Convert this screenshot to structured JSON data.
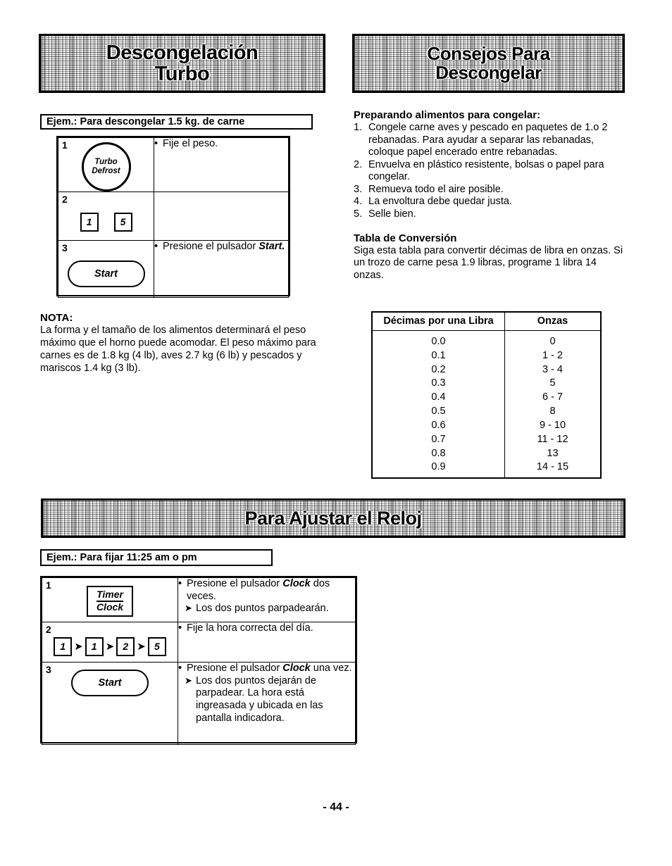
{
  "page": {
    "number_label": "- 44 -"
  },
  "sections": {
    "defrost": {
      "banner_line1": "Descongelación",
      "banner_line2": "Turbo",
      "example_label": "Ejem.: Para descongelar 1.5 kg. de carne",
      "steps": [
        {
          "num": "1",
          "key_type": "circle",
          "key_line1": "Turbo",
          "key_line2": "Defrost",
          "desc_bullet": "Fije el peso."
        },
        {
          "num": "2",
          "key_type": "squares",
          "keys": [
            "1",
            "5"
          ],
          "desc_bullet": ""
        },
        {
          "num": "3",
          "key_type": "start",
          "key_label": "Start",
          "desc_bullet": "Presione el pulsador",
          "desc_bold": "Start."
        }
      ],
      "note_heading": "NOTA:",
      "note_text": "La forma y el tamaño de los alimentos determinará el peso máximo que el horno puede acomodar. El peso máximo para carnes es de 1.8 kg (4 lb), aves 2.7 kg (6 lb) y pescados y mariscos 1.4 kg (3 lb)."
    },
    "tips": {
      "banner_line1": "Consejos Para",
      "banner_line2": "Descongelar",
      "prep_heading": "Preparando alimentos para congelar:",
      "prep_items": [
        {
          "n": "1.",
          "text": "Congele carne aves y pescado en paquetes de 1.o 2 rebanadas. Para ayudar a separar las rebanadas, coloque papel encerado entre rebanadas."
        },
        {
          "n": "2.",
          "text": "Envuelva en plástico resistente, bolsas o papel para congelar."
        },
        {
          "n": "3.",
          "text": "Remueva todo el aire posible."
        },
        {
          "n": "4.",
          "text": "La envoltura debe quedar justa."
        },
        {
          "n": "5.",
          "text": "Selle bien."
        }
      ],
      "conv_heading": "Tabla de Conversión",
      "conv_intro": "Siga esta tabla para convertir décimas de libra en onzas. Si un trozo de carne pesa 1.9 libras, programe 1 libra 14 onzas.",
      "conv_table": {
        "headers": [
          "Décimas por una Libra",
          "Onzas"
        ],
        "rows": [
          [
            "0.0",
            "0"
          ],
          [
            "0.1",
            "1 - 2"
          ],
          [
            "0.2",
            "3 - 4"
          ],
          [
            "0.3",
            "5"
          ],
          [
            "0.4",
            "6 - 7"
          ],
          [
            "0.5",
            "8"
          ],
          [
            "0.6",
            "9 - 10"
          ],
          [
            "0.7",
            "11 - 12"
          ],
          [
            "0.8",
            "13"
          ],
          [
            "0.9",
            "14 - 15"
          ]
        ]
      }
    },
    "clock": {
      "banner_title": "Para Ajustar el Reloj",
      "example_label": "Ejem.: Para fijar 11:25 am o pm",
      "steps": [
        {
          "num": "1",
          "key_type": "rect",
          "key_line1": "Timer",
          "key_line2": "Clock",
          "desc_pre": "Presione el pulsador",
          "desc_bold": "Clock",
          "desc_post": "dos veces.",
          "desc_arrow": "Los dos puntos parpadearán."
        },
        {
          "num": "2",
          "key_type": "sequence",
          "keys": [
            "1",
            "1",
            "2",
            "5"
          ],
          "desc_pre": "Fije la hora correcta del día.",
          "desc_bold": "",
          "desc_post": "",
          "desc_arrow": ""
        },
        {
          "num": "3",
          "key_type": "start",
          "key_label": "Start",
          "desc_pre": "Presione el pulsador",
          "desc_bold": "Clock",
          "desc_post": "una vez.",
          "desc_arrow": "Los dos puntos dejarán de parpadear. La hora está ingreasada y ubicada en las pantalla indicadora."
        }
      ]
    }
  }
}
